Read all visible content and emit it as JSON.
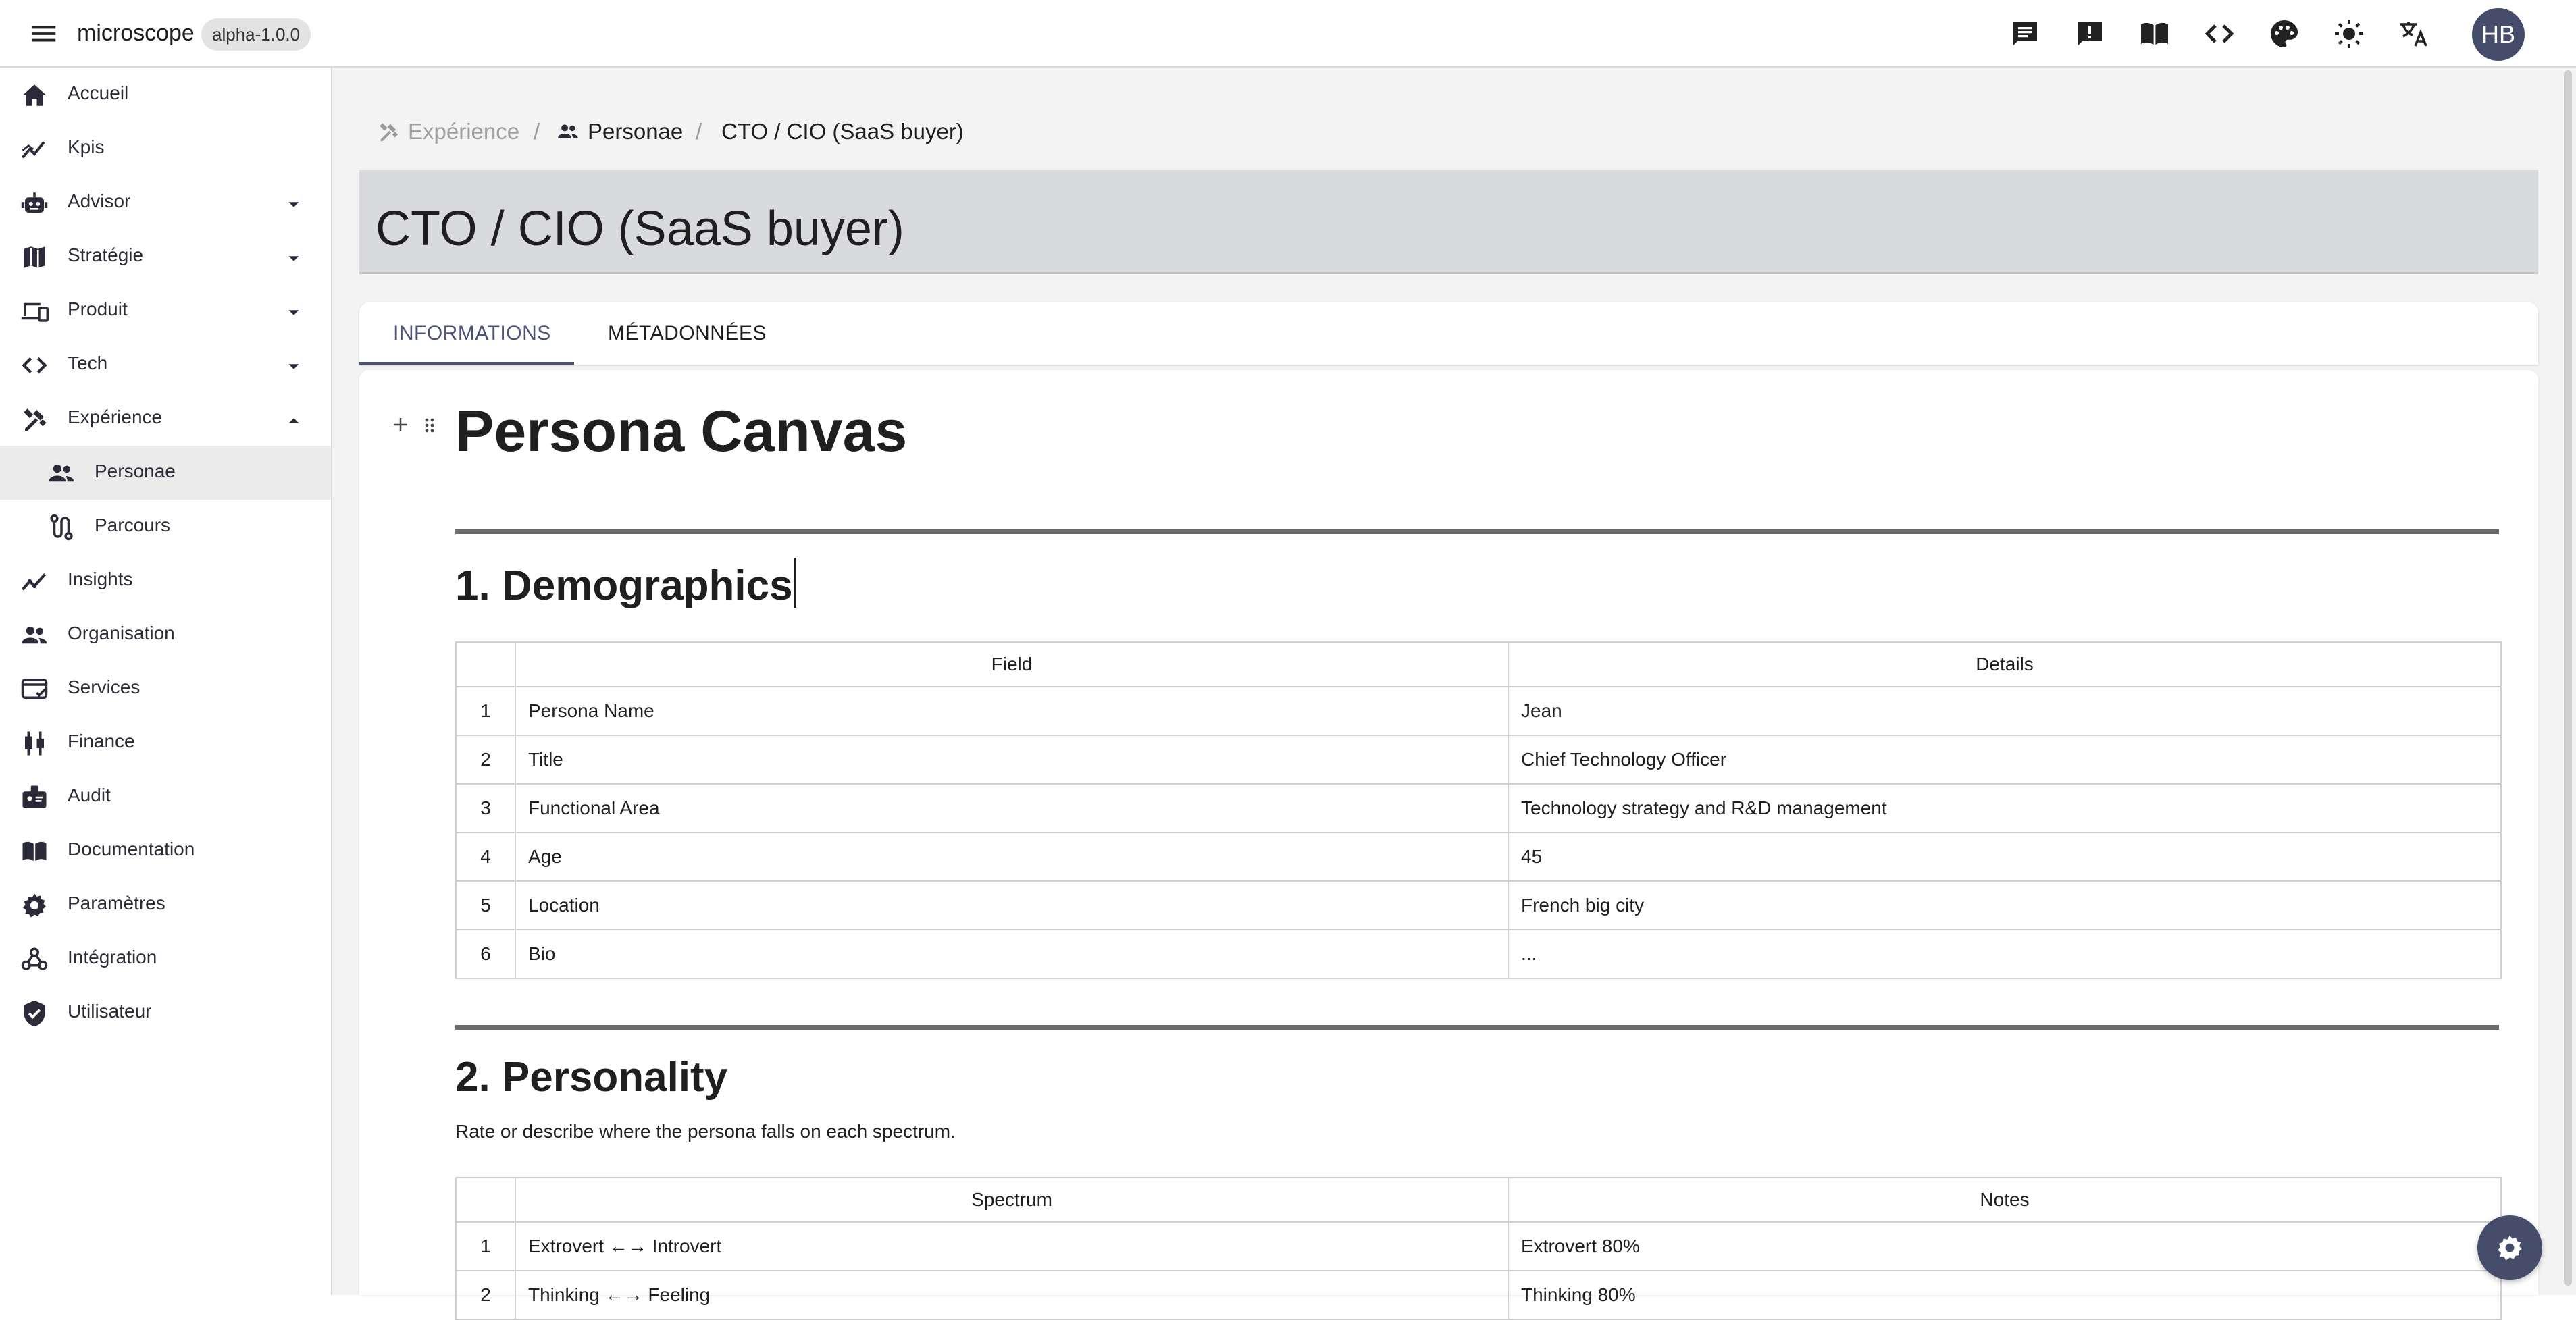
{
  "topbar": {
    "app_name": "microscope",
    "version": "alpha-1.0.0",
    "avatar_initials": "HB",
    "icons": [
      "chat-icon",
      "feedback-icon",
      "docs-book-icon",
      "code-icon",
      "palette-icon",
      "brightness-icon",
      "translate-icon"
    ]
  },
  "sidebar": {
    "items": [
      {
        "label": "Accueil",
        "icon": "home-icon"
      },
      {
        "label": "Kpis",
        "icon": "trend-icon"
      },
      {
        "label": "Advisor",
        "icon": "robot-icon",
        "expandable": true
      },
      {
        "label": "Stratégie",
        "icon": "map-icon",
        "expandable": true
      },
      {
        "label": "Produit",
        "icon": "devices-icon",
        "expandable": true
      },
      {
        "label": "Tech",
        "icon": "code-icon",
        "expandable": true
      },
      {
        "label": "Expérience",
        "icon": "design-tools-icon",
        "expanded": true
      },
      {
        "label": "Personae",
        "icon": "people-icon",
        "sub": true,
        "active": true
      },
      {
        "label": "Parcours",
        "icon": "route-icon",
        "sub": true
      },
      {
        "label": "Insights",
        "icon": "insights-icon"
      },
      {
        "label": "Organisation",
        "icon": "group-icon"
      },
      {
        "label": "Services",
        "icon": "service-card-icon"
      },
      {
        "label": "Finance",
        "icon": "candlestick-icon"
      },
      {
        "label": "Audit",
        "icon": "badge-icon"
      },
      {
        "label": "Documentation",
        "icon": "book-icon"
      },
      {
        "label": "Paramètres",
        "icon": "gear-icon"
      },
      {
        "label": "Intégration",
        "icon": "webhook-icon"
      },
      {
        "label": "Utilisateur",
        "icon": "shield-check-icon"
      }
    ]
  },
  "breadcrumb": {
    "section": "Expérience",
    "sep1": "/",
    "list": "Personae",
    "sep2": "/",
    "current": "CTO / CIO (SaaS buyer)"
  },
  "page": {
    "title": "CTO / CIO (SaaS buyer)",
    "tabs": [
      {
        "label": "INFORMATIONS",
        "active": true
      },
      {
        "label": "MÉTADONNÉES",
        "active": false
      }
    ]
  },
  "document": {
    "h1": "Persona Canvas",
    "section1": {
      "heading": "1. Demographics",
      "headers": [
        "",
        "Field",
        "Details"
      ],
      "rows": [
        [
          "1",
          "Persona Name",
          "Jean"
        ],
        [
          "2",
          "Title",
          "Chief Technology Officer"
        ],
        [
          "3",
          "Functional Area",
          "Technology strategy and R&D management"
        ],
        [
          "4",
          "Age",
          "45"
        ],
        [
          "5",
          "Location",
          "French big city"
        ],
        [
          "6",
          "Bio",
          "..."
        ]
      ]
    },
    "section2": {
      "heading": "2. Personality",
      "intro": "Rate or describe where the persona falls on each spectrum.",
      "headers": [
        "",
        "Spectrum",
        "Notes"
      ],
      "rows": [
        [
          "1",
          "Extrovert ←→ Introvert",
          "Extrovert 80%"
        ],
        [
          "2",
          "Thinking ←→ Feeling",
          "Thinking 80%"
        ]
      ]
    }
  },
  "colors": {
    "accent": "#4a5275",
    "avatar_bg": "#454d6a",
    "title_band": "#d9dadd",
    "background": "#f3f3f4"
  }
}
